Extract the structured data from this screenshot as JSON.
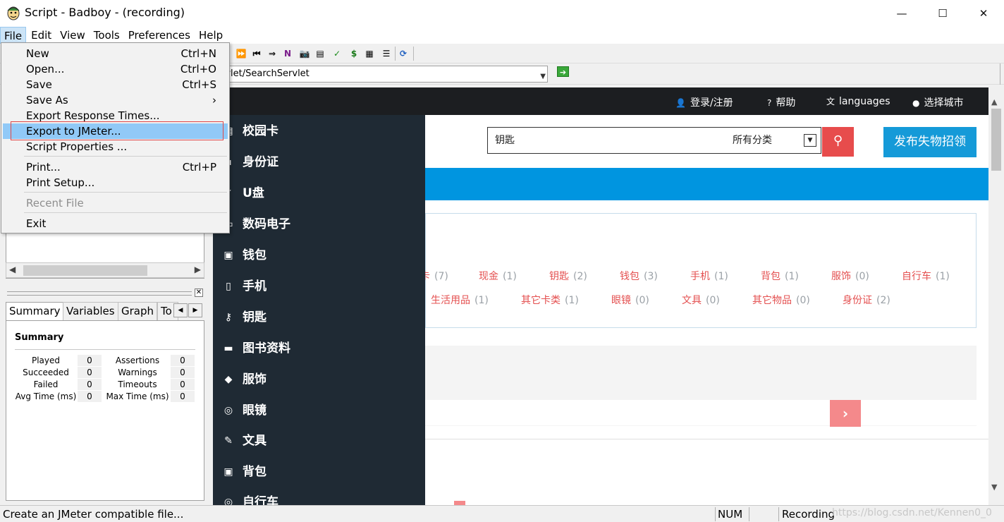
{
  "window": {
    "title": "Script - Badboy - (recording)",
    "controls": {
      "minimize": "—",
      "maximize": "☐",
      "close": "✕"
    }
  },
  "menubar": [
    "File",
    "Edit",
    "View",
    "Tools",
    "Preferences",
    "Help"
  ],
  "file_menu": {
    "items": [
      {
        "label": "New",
        "shortcut": "Ctrl+N"
      },
      {
        "label": "Open...",
        "shortcut": "Ctrl+O"
      },
      {
        "label": "Save",
        "shortcut": "Ctrl+S"
      },
      {
        "label": "Save As",
        "shortcut": "›"
      },
      {
        "label": "Export Response Times...",
        "shortcut": ""
      },
      {
        "label": "Export to JMeter...",
        "shortcut": ""
      },
      {
        "label": "Script Properties ...",
        "shortcut": ""
      },
      {
        "label": "Print...",
        "shortcut": "Ctrl+P"
      },
      {
        "label": "Print Setup...",
        "shortcut": ""
      },
      {
        "label": "Recent File",
        "shortcut": ""
      },
      {
        "label": "Exit",
        "shortcut": ""
      }
    ]
  },
  "toolbar": {
    "buttons": [
      "⏩",
      "⏮",
      "⇒",
      "N",
      "📷",
      "▤",
      "✓",
      "$",
      "▦",
      "☰",
      "⟳"
    ]
  },
  "address": {
    "url": "rvlet/SearchServlet",
    "go_label": "➔"
  },
  "left_panel": {
    "tabs": [
      "Summary",
      "Variables",
      "Graph",
      "To"
    ],
    "summary": {
      "title": "Summary",
      "left_rows": [
        {
          "label": "Played",
          "value": "0"
        },
        {
          "label": "Succeeded",
          "value": "0"
        },
        {
          "label": "Failed",
          "value": "0"
        },
        {
          "label": "Avg Time (ms)",
          "value": "0"
        }
      ],
      "right_rows": [
        {
          "label": "Assertions",
          "value": "0"
        },
        {
          "label": "Warnings",
          "value": "0"
        },
        {
          "label": "Timeouts",
          "value": "0"
        },
        {
          "label": "Max Time (ms)",
          "value": "0"
        }
      ]
    }
  },
  "site": {
    "topnav": [
      {
        "icon": "👤",
        "label": "登录/注册"
      },
      {
        "icon": "?",
        "label": "帮助"
      },
      {
        "icon": "文",
        "label": "languages"
      },
      {
        "icon": "●",
        "label": "选择城市"
      }
    ],
    "search": {
      "value": "钥匙",
      "category": "所有分类",
      "button": "⚲"
    },
    "publish_label": "发布失物招领",
    "sidenav": [
      {
        "icon": "▤",
        "label": "校园卡"
      },
      {
        "icon": "▪",
        "label": "身份证"
      },
      {
        "icon": "✓",
        "label": "U盘"
      },
      {
        "icon": "▭",
        "label": "数码电子"
      },
      {
        "icon": "▣",
        "label": "钱包"
      },
      {
        "icon": "▯",
        "label": "手机"
      },
      {
        "icon": "⚷",
        "label": "钥匙"
      },
      {
        "icon": "▬",
        "label": "图书资料"
      },
      {
        "icon": "◆",
        "label": "服饰"
      },
      {
        "icon": "◎",
        "label": "眼镜"
      },
      {
        "icon": "✎",
        "label": "文具"
      },
      {
        "icon": "▣",
        "label": "背包"
      },
      {
        "icon": "◎",
        "label": "自行车"
      }
    ],
    "categories_row1": [
      {
        "label": "卡",
        "count": "(7)"
      },
      {
        "label": "现金",
        "count": "(1)"
      },
      {
        "label": "钥匙",
        "count": "(2)"
      },
      {
        "label": "钱包",
        "count": "(3)"
      },
      {
        "label": "手机",
        "count": "(1)"
      },
      {
        "label": "背包",
        "count": "(1)"
      },
      {
        "label": "服饰",
        "count": "(0)"
      },
      {
        "label": "自行车",
        "count": "(1)"
      }
    ],
    "categories_row2": [
      {
        "label": "生活用品",
        "count": "(1)"
      },
      {
        "label": "其它卡类",
        "count": "(1)"
      },
      {
        "label": "眼镜",
        "count": "(0)"
      },
      {
        "label": "文具",
        "count": "(0)"
      },
      {
        "label": "其它物品",
        "count": "(0)"
      },
      {
        "label": "身份证",
        "count": "(2)"
      }
    ],
    "next_label": "›"
  },
  "statusbar": {
    "message": "Create an JMeter compatible file...",
    "num": "NUM",
    "recording": "Recording",
    "watermark": "https://blog.csdn.net/Kennen0_0"
  }
}
